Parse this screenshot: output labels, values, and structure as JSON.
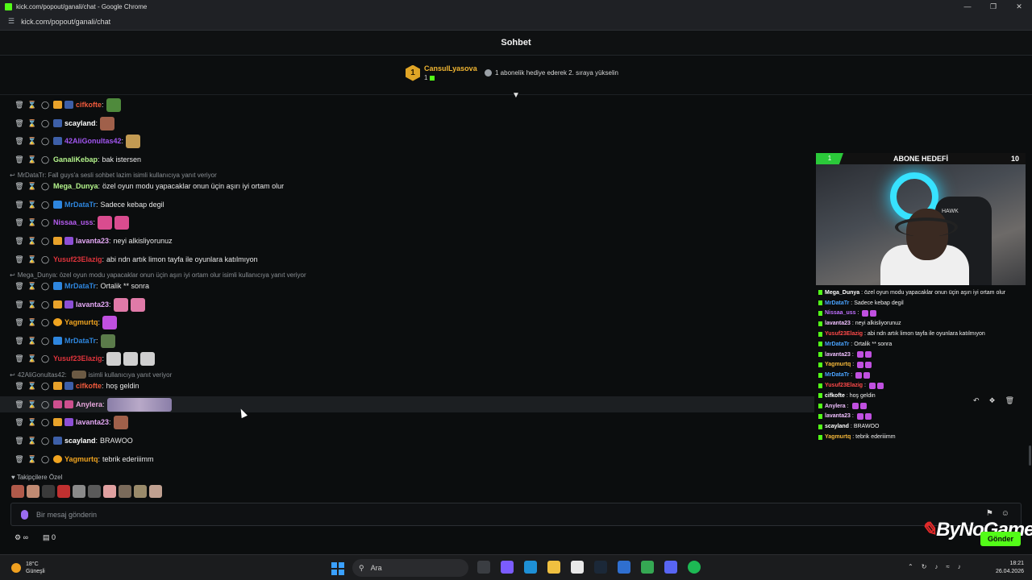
{
  "window": {
    "title": "kick.com/popout/ganali/chat - Google Chrome",
    "url": "kick.com/popout/ganali/chat"
  },
  "header": {
    "title": "Sohbet"
  },
  "pinned": {
    "rank": "1",
    "username": "CansulLyasova",
    "count": "1",
    "gift_hint": "1 abonelik hediye ederek 2. sıraya yükselin"
  },
  "replies": [
    {
      "text": "MrDataTr: Fall guys'a sesli sohbet lazim isimli kullanıcıya yanıt veriyor"
    },
    {
      "text": "Mega_Dunya: özel oyun modu yapacaklar onun üçin aşırı iyi ortam olur isimli kullanıcıya yanıt veriyor"
    },
    {
      "text": "42AliGonultas42:",
      "suffix": "isimli kullanıcıya yanıt veriyor"
    }
  ],
  "messages": [
    {
      "user": "cifkofte",
      "color": "#f05a3c",
      "text": ""
    },
    {
      "user": "scayland",
      "color": "#ffffff",
      "text": ""
    },
    {
      "user": "42AliGonultas42",
      "color": "#a155f0",
      "text": ""
    },
    {
      "user": "GanaliKebap",
      "color": "#b5f58c",
      "text": "bak istersen"
    },
    {
      "user": "Mega_Dunya",
      "color": "#b5f58c",
      "text": "özel oyun modu yapacaklar onun üçin aşırı iyi ortam olur"
    },
    {
      "user": "MrDataTr",
      "color": "#2e86de",
      "text": "Sadece kebap degil"
    },
    {
      "user": "Nissaa_uss",
      "color": "#b55cf0",
      "text": ""
    },
    {
      "user": "lavanta23",
      "color": "#e4a8f5",
      "text": "neyi alkisliyorunuz"
    },
    {
      "user": "Yusuf23Elazig",
      "color": "#e0343c",
      "text": "abi ndn artık limon tayfa ile oyunlara katılmıyon"
    },
    {
      "user": "MrDataTr",
      "color": "#2e86de",
      "text": "Ortalik ** sonra"
    },
    {
      "user": "lavanta23",
      "color": "#e4a8f5",
      "text": ""
    },
    {
      "user": "Yagmurtq",
      "color": "#f0a420",
      "text": ""
    },
    {
      "user": "MrDataTr",
      "color": "#2e86de",
      "text": ""
    },
    {
      "user": "Yusuf23Elazig",
      "color": "#e0343c",
      "text": ""
    },
    {
      "user": "cifkofte",
      "color": "#f05a3c",
      "text": "hoş geldin"
    },
    {
      "user": "Anylera",
      "color": "#e7a6dc",
      "text": ""
    },
    {
      "user": "lavanta23",
      "color": "#e4a8f5",
      "text": ""
    },
    {
      "user": "scayland",
      "color": "#ffffff",
      "text": "BRAWOO"
    },
    {
      "user": "Yagmurtq",
      "color": "#f0a420",
      "text": "tebrik ederiiimm"
    }
  ],
  "followers_label": "Takipçilere Özel",
  "input": {
    "placeholder": "Bir mesaj gönderin",
    "send_label": "Gönder",
    "count": "0"
  },
  "overlay": {
    "goal_label": "ABONE HEDEFİ",
    "goal_current": "1",
    "goal_target": "10",
    "brand": "ByNoGame",
    "cam_logo": "HAWK",
    "mini": [
      {
        "user": "Mega_Dunya",
        "color": "#ffffff",
        "text": "özel oyun modu yapacaklar onun üçin aşırı iyi ortam olur"
      },
      {
        "user": "MrDataTr",
        "color": "#4aa3ff",
        "text": "Sadece kebap degil"
      },
      {
        "user": "Nissaa_uss",
        "color": "#c070ff",
        "text": ""
      },
      {
        "user": "lavanta23",
        "color": "#f0c0ff",
        "text": "neyi alkisliyorunuz"
      },
      {
        "user": "Yusuf23Elazig",
        "color": "#ff4a4a",
        "text": "abi ndn artık limon tayfa ile oyunlara katılmıyon"
      },
      {
        "user": "MrDataTr",
        "color": "#4aa3ff",
        "text": "Ortalik ** sonra"
      },
      {
        "user": "lavanta23",
        "color": "#f0c0ff",
        "text": ""
      },
      {
        "user": "Yagmurtq",
        "color": "#f5b83a",
        "text": ""
      },
      {
        "user": "MrDataTr",
        "color": "#4aa3ff",
        "text": ""
      },
      {
        "user": "Yusuf23Elazig",
        "color": "#ff4a4a",
        "text": ""
      },
      {
        "user": "cifkofte",
        "color": "#ffffff",
        "text": "hoş geldin"
      },
      {
        "user": "Anylera",
        "color": "#f0c0ff",
        "text": ""
      },
      {
        "user": "lavanta23",
        "color": "#f0c0ff",
        "text": ""
      },
      {
        "user": "scayland",
        "color": "#ffffff",
        "text": "BRAWOO"
      },
      {
        "user": "Yagmurtq",
        "color": "#f5b83a",
        "text": "tebrik ederiiimm"
      }
    ]
  },
  "taskbar": {
    "temp": "18°C",
    "weather": "Güneşli",
    "search": "Ara",
    "time": "18:21",
    "date": "26.04.2026"
  },
  "colors": {
    "accent": "#53fc18",
    "gold": "#f0b532"
  }
}
